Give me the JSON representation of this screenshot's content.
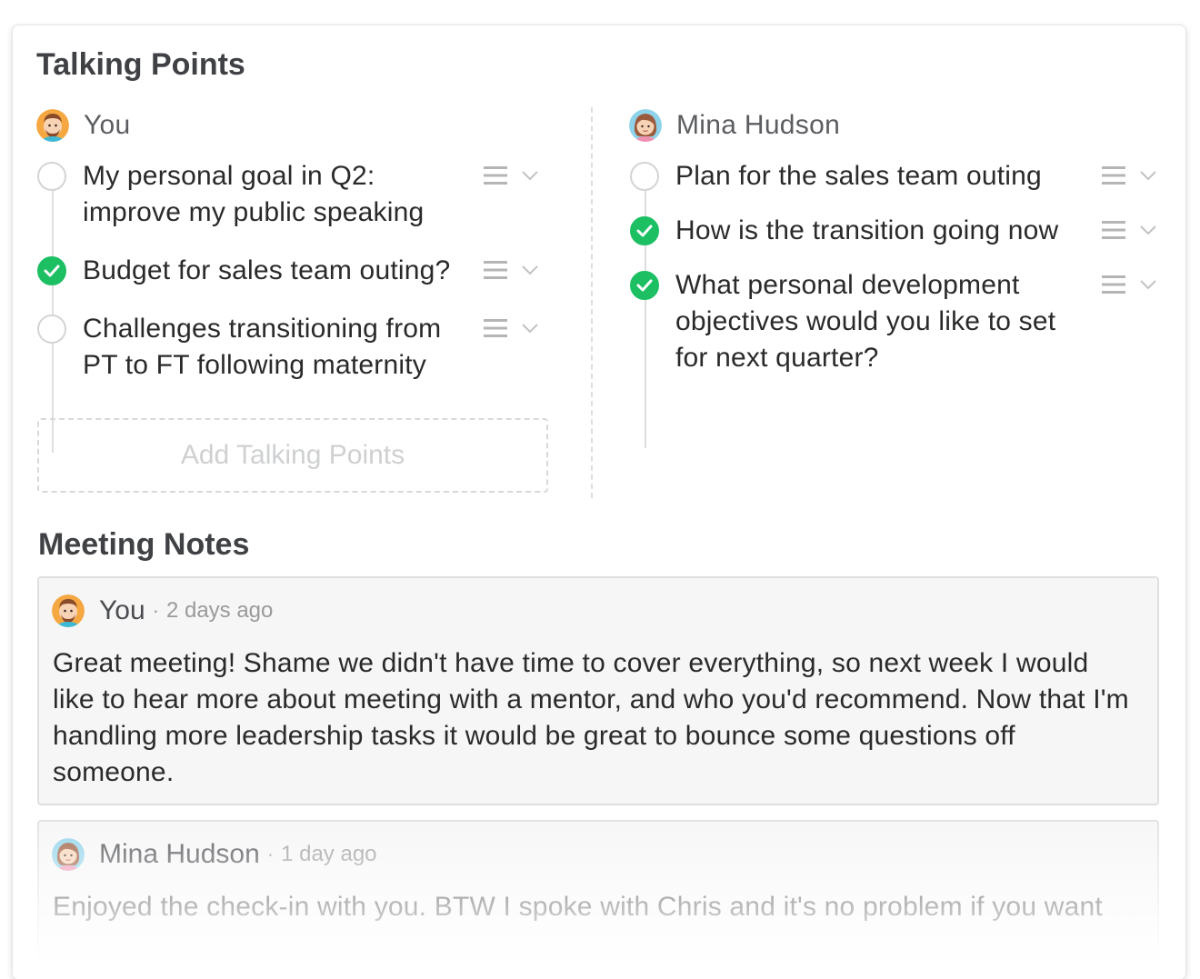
{
  "talking_points": {
    "title": "Talking Points",
    "you": {
      "name": "You",
      "items": [
        {
          "text": "My personal goal in Q2: improve my public speaking",
          "done": false
        },
        {
          "text": "Budget for sales team outing?",
          "done": true
        },
        {
          "text": "Challenges transitioning from PT to FT following maternity",
          "done": false
        }
      ],
      "add_label": "Add Talking Points"
    },
    "other": {
      "name": "Mina Hudson",
      "items": [
        {
          "text": "Plan for the sales team outing",
          "done": false
        },
        {
          "text": "How is the transition going now",
          "done": true
        },
        {
          "text": "What personal development objectives would you like to set for next quarter?",
          "done": true
        }
      ]
    }
  },
  "meeting_notes": {
    "title": "Meeting Notes",
    "notes": [
      {
        "author": "You",
        "separator": "·",
        "time": "2 days ago",
        "body": "Great meeting! Shame we didn't have time to cover everything, so next week I would like to hear more about meeting with a mentor, and who you'd recommend. Now that I'm handling more leadership tasks it would be great to bounce some questions off someone."
      },
      {
        "author": "Mina Hudson",
        "separator": "·",
        "time": "1 day ago",
        "body": "Enjoyed the check-in with you. BTW I spoke with Chris and it's no problem if you want"
      }
    ]
  },
  "colors": {
    "done_green": "#1dbf63",
    "open_border": "#d4d4d4",
    "muted_text": "#9a9a9a"
  },
  "icons": {
    "done": "checkmark-icon",
    "drag": "hamburger-icon",
    "expand": "chevron-down-icon"
  }
}
